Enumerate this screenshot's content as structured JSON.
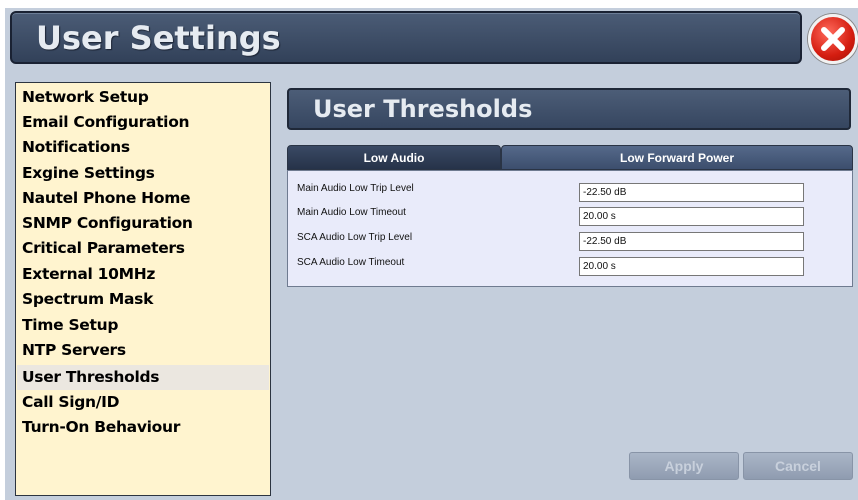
{
  "window": {
    "title": "User Settings"
  },
  "sidebar": {
    "items": [
      {
        "label": "Network Setup"
      },
      {
        "label": "Email Configuration"
      },
      {
        "label": "Notifications"
      },
      {
        "label": "Exgine Settings"
      },
      {
        "label": "Nautel Phone Home"
      },
      {
        "label": "SNMP Configuration"
      },
      {
        "label": "Critical Parameters"
      },
      {
        "label": "External 10MHz"
      },
      {
        "label": "Spectrum Mask"
      },
      {
        "label": "Time Setup"
      },
      {
        "label": "NTP Servers"
      },
      {
        "label": "User Thresholds",
        "active": true
      },
      {
        "label": "Call Sign/ID"
      },
      {
        "label": "Turn-On Behaviour"
      }
    ]
  },
  "main": {
    "section_title": "User Thresholds",
    "tabs": [
      {
        "label": "Low Audio",
        "selected": true
      },
      {
        "label": "Low Forward Power",
        "selected": false
      }
    ],
    "fields": [
      {
        "label": "Main Audio Low Trip Level",
        "value": "-22.50 dB"
      },
      {
        "label": "Main Audio Low Timeout",
        "value": "20.00 s"
      },
      {
        "label": "SCA Audio Low Trip Level",
        "value": "-22.50 dB"
      },
      {
        "label": "SCA Audio Low Timeout",
        "value": "20.00 s"
      }
    ],
    "buttons": {
      "apply_label": "Apply",
      "cancel_label": "Cancel"
    }
  },
  "icons": {
    "close": "close-icon"
  },
  "colors": {
    "title_bar": "#3a4a64",
    "sidebar_bg": "#fff4cf",
    "close_red": "#d41d10",
    "panel_bg": "#c4cedc"
  }
}
